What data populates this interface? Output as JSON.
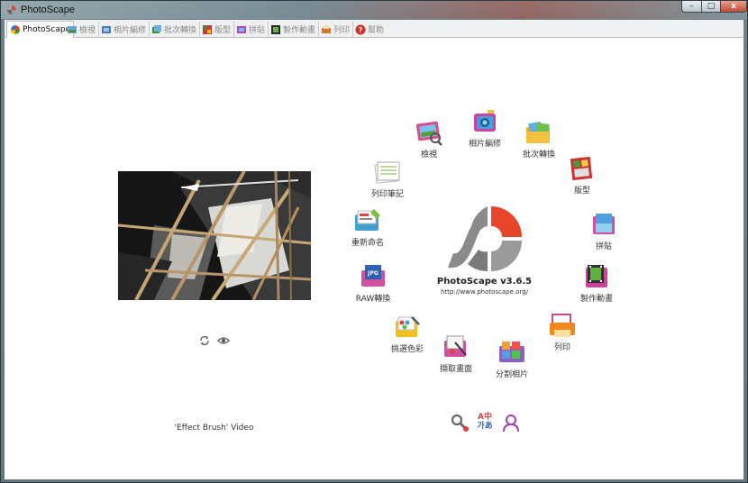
{
  "window": {
    "title": "PhotoScape",
    "minimize_glyph": "–",
    "maximize_glyph": "□",
    "close_glyph": "x"
  },
  "tabs": [
    {
      "label": "PhotoScape",
      "icon": "photoscape-icon",
      "active": true
    },
    {
      "label": "檢視",
      "icon": "viewer-icon"
    },
    {
      "label": "相片編修",
      "icon": "editor-icon"
    },
    {
      "label": "批次轉換",
      "icon": "batch-icon"
    },
    {
      "label": "版型",
      "icon": "page-icon"
    },
    {
      "label": "拼貼",
      "icon": "combine-icon"
    },
    {
      "label": "製作動畫",
      "icon": "animated-gif-icon"
    },
    {
      "label": "列印",
      "icon": "print-icon"
    },
    {
      "label": "幫助",
      "icon": "help-icon"
    }
  ],
  "preview": {
    "caption": "'Effect Brush' Video"
  },
  "launcher": {
    "logo_title": "PhotoScape v3.6.5",
    "logo_url": "http://www.photoscape.org/",
    "items": [
      {
        "label": "檢視",
        "icon": "viewer-icon"
      },
      {
        "label": "相片編修",
        "icon": "editor-icon"
      },
      {
        "label": "批次轉換",
        "icon": "batch-icon"
      },
      {
        "label": "版型",
        "icon": "page-icon"
      },
      {
        "label": "拼貼",
        "icon": "combine-icon"
      },
      {
        "label": "製作動畫",
        "icon": "animated-gif-icon"
      },
      {
        "label": "列印",
        "icon": "print-icon"
      },
      {
        "label": "分割相片",
        "icon": "splitter-icon"
      },
      {
        "label": "擷取畫面",
        "icon": "screen-capture-icon"
      },
      {
        "label": "挑選色彩",
        "icon": "color-picker-icon"
      },
      {
        "label": "RAW轉換",
        "icon": "raw-converter-icon"
      },
      {
        "label": "重新命名",
        "icon": "rename-icon"
      },
      {
        "label": "列印筆記",
        "icon": "paper-print-icon"
      }
    ]
  },
  "utilities": {
    "language_label_top": "A中",
    "language_label_bottom": "가あ"
  },
  "colors": {
    "accent_red": "#e8462b",
    "logo_gray": "#8a8a8a",
    "tab_active_bg": "#ffffff"
  }
}
